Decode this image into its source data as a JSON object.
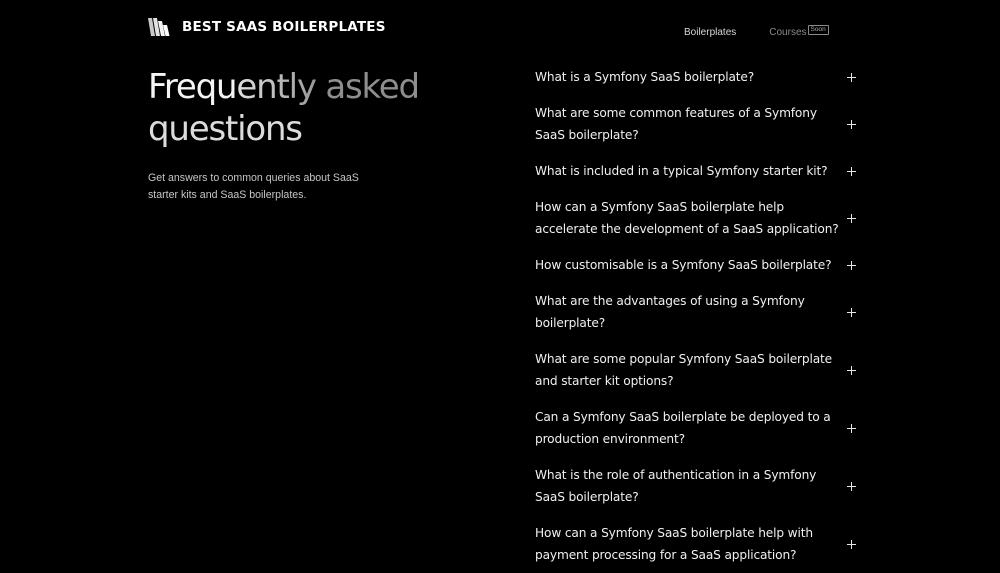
{
  "header": {
    "brand": "BEST SAAS BOILERPLATES",
    "logo_icon": "stacked-slashes-logo",
    "nav": [
      {
        "label": "Boilerplates"
      },
      {
        "label": "Courses",
        "badge": "Soon"
      }
    ]
  },
  "hero": {
    "title_words": [
      "Frequently",
      "asked",
      "questions"
    ],
    "title_part1": "Frequ",
    "title_part2": "ently",
    "subtitle": "Get answers to common queries about SaaS starter kits and SaaS boilerplates."
  },
  "faq": {
    "expand_icon": "plus-icon",
    "items": [
      {
        "question": "What is a Symfony SaaS boilerplate?"
      },
      {
        "question": "What are some common features of a Symfony SaaS boilerplate?"
      },
      {
        "question": "What is included in a typical Symfony starter kit?"
      },
      {
        "question": "How can a Symfony SaaS boilerplate help accelerate the development of a SaaS application?"
      },
      {
        "question": "How customisable is a Symfony SaaS boilerplate?"
      },
      {
        "question": "What are the advantages of using a Symfony boilerplate?"
      },
      {
        "question": "What are some popular Symfony SaaS boilerplate and starter kit options?"
      },
      {
        "question": "Can a Symfony SaaS boilerplate be deployed to a production environment?"
      },
      {
        "question": "What is the role of authentication in a Symfony SaaS boilerplate?"
      },
      {
        "question": "How can a Symfony SaaS boilerplate help with payment processing for a SaaS application?"
      }
    ]
  },
  "colors": {
    "background": "#000000",
    "text": "#ffffff",
    "muted": "#8a8a8a"
  }
}
